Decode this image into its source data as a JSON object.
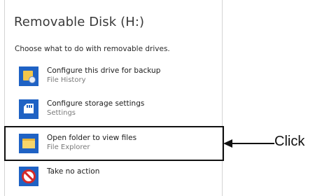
{
  "dialog": {
    "title": "Removable Disk (H:)",
    "subtitle": "Choose what to do with removable drives.",
    "options": [
      {
        "title": "Configure this drive for backup",
        "subtitle": "File History",
        "icon": "backup-icon"
      },
      {
        "title": "Configure storage settings",
        "subtitle": "Settings",
        "icon": "storage-card-icon"
      },
      {
        "title": "Open folder to view files",
        "subtitle": "File Explorer",
        "icon": "file-explorer-icon",
        "highlighted": true
      },
      {
        "title": "Take no action",
        "subtitle": "",
        "icon": "no-action-icon"
      }
    ]
  },
  "annotation": {
    "label": "Click"
  },
  "colors": {
    "accent": "#1f62c4",
    "highlight_border": "#111111",
    "no_action_red": "#d42a2a"
  }
}
